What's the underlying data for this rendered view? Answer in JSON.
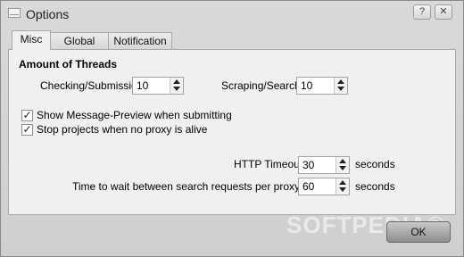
{
  "window": {
    "title": "Options"
  },
  "titlebar_buttons": {
    "help": "?",
    "close": "✕"
  },
  "tabs": [
    {
      "label": "Misc"
    },
    {
      "label": "Global Filter"
    },
    {
      "label": "Notification"
    }
  ],
  "misc": {
    "section_title": "Amount of Threads",
    "checking_label": "Checking/Submission",
    "checking_value": "10",
    "scraping_label": "Scraping/Search",
    "scraping_value": "10",
    "show_preview_label": "Show Message-Preview when submitting",
    "show_preview_checked": true,
    "stop_projects_label": "Stop projects when no proxy is alive",
    "stop_projects_checked": true,
    "http_timeout_label": "HTTP Timeout",
    "http_timeout_value": "30",
    "http_timeout_unit": "seconds",
    "wait_label": "Time to wait between search requests per proxy/IP",
    "wait_value": "60",
    "wait_unit": "seconds"
  },
  "footer": {
    "ok_label": "OK"
  },
  "watermark": "SOFTPEDIA®",
  "icons": {
    "app": "envelope-icon",
    "help": "question-icon",
    "close": "close-icon"
  }
}
